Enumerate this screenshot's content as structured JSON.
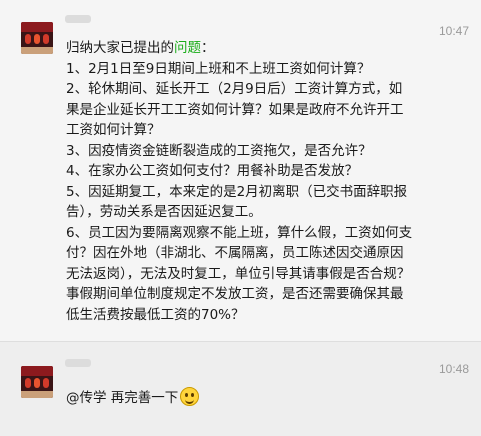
{
  "messages": [
    {
      "time": "10:47",
      "intro_before": "归纳大家已提出的",
      "intro_link": "问题",
      "intro_after": "：",
      "body": "1、2月1日至9日期间上班和不上班工资如何计算？\n2、轮休期间、延长开工（2月9日后）工资计算方式，如果是企业延长开工工资如何计算？如果是政府不允许开工工资如何计算？\n3、因疫情资金链断裂造成的工资拖欠，是否允许？\n4、在家办公工资如何支付？用餐补助是否发放？\n5、因延期复工，本来定的是2月初离职（已交书面辞职报告），劳动关系是否因延迟复工。\n6、员工因为要隔离观察不能上班，算什么假，工资如何支付？因在外地（非湖北、不属隔离，员工陈述因交通原因无法返岗），无法及时复工，单位引导其请事假是否合规？事假期间单位制度规定不发放工资，是否还需要确保其最低生活费按最低工资的70%？"
    },
    {
      "time": "10:48",
      "text": "@传学 再完善一下",
      "emoji_icon": "smile-emoji-icon"
    }
  ]
}
